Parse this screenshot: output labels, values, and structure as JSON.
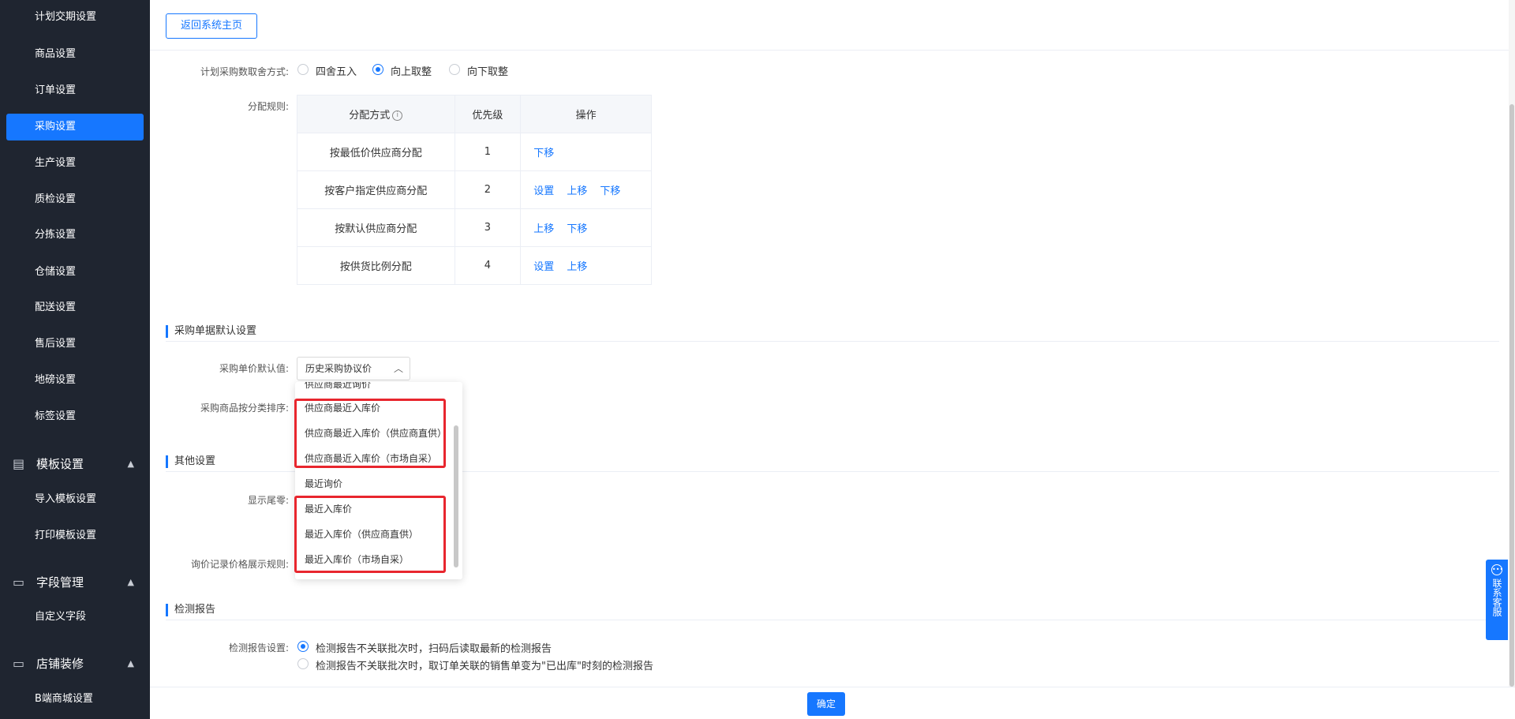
{
  "sidebar": {
    "items": [
      {
        "label": "计划交期设置"
      },
      {
        "label": "商品设置"
      },
      {
        "label": "订单设置"
      },
      {
        "label": "采购设置",
        "active": true
      },
      {
        "label": "生产设置"
      },
      {
        "label": "质检设置"
      },
      {
        "label": "分拣设置"
      },
      {
        "label": "仓储设置"
      },
      {
        "label": "配送设置"
      },
      {
        "label": "售后设置"
      },
      {
        "label": "地磅设置"
      },
      {
        "label": "标签设置"
      }
    ],
    "groups": [
      {
        "label": "模板设置",
        "icon": "template-icon",
        "children": [
          {
            "label": "导入模板设置"
          },
          {
            "label": "打印模板设置"
          }
        ]
      },
      {
        "label": "字段管理",
        "icon": "field-icon",
        "children": [
          {
            "label": "自定义字段"
          }
        ]
      },
      {
        "label": "店铺装修",
        "icon": "store-icon",
        "children": [
          {
            "label": "B端商城设置"
          }
        ]
      }
    ]
  },
  "topbar": {
    "back_label": "返回系统主页"
  },
  "rounding": {
    "label": "计划采购数取舍方式:",
    "options": [
      {
        "label": "四舍五入",
        "selected": false
      },
      {
        "label": "向上取整",
        "selected": true
      },
      {
        "label": "向下取整",
        "selected": false
      }
    ]
  },
  "allocation": {
    "label": "分配规则:",
    "headers": [
      "分配方式",
      "优先级",
      "操作"
    ],
    "rows": [
      {
        "method": "按最低价供应商分配",
        "priority": "1",
        "ops": [
          "下移"
        ]
      },
      {
        "method": "按客户指定供应商分配",
        "priority": "2",
        "ops": [
          "设置",
          "上移",
          "下移"
        ]
      },
      {
        "method": "按默认供应商分配",
        "priority": "3",
        "ops": [
          "上移",
          "下移"
        ]
      },
      {
        "method": "按供货比例分配",
        "priority": "4",
        "ops": [
          "设置",
          "上移"
        ]
      }
    ]
  },
  "purchase_defaults": {
    "section_title": "采购单据默认设置",
    "unit_price_label": "采购单价默认值:",
    "unit_price_value": "历史采购协议价",
    "sort_label": "采购商品按分类排序:",
    "dropdown_options": [
      "供应商最近询价",
      "供应商最近入库价",
      "供应商最近入库价（供应商直供）",
      "供应商最近入库价（市场自采）",
      "最近询价",
      "最近入库价",
      "最近入库价（供应商直供）",
      "最近入库价（市场自采）"
    ]
  },
  "other": {
    "section_title": "其他设置",
    "tail_label": "显示尾零:",
    "inquiry_label": "询价记录价格展示规则:"
  },
  "report": {
    "section_title": "检测报告",
    "label": "检测报告设置:",
    "options": [
      {
        "label": "检测报告不关联批次时，扫码后读取最新的检测报告",
        "selected": true
      },
      {
        "label": "检测报告不关联批次时，取订单关联的销售单变为\"已出库\"时刻的检测报告",
        "selected": false
      }
    ]
  },
  "contact": {
    "label": "联系客服"
  },
  "footer": {
    "confirm_label": "确定"
  },
  "colors": {
    "primary": "#1677ff",
    "sidebar_bg": "#1f2530",
    "highlight": "#e8262e"
  }
}
